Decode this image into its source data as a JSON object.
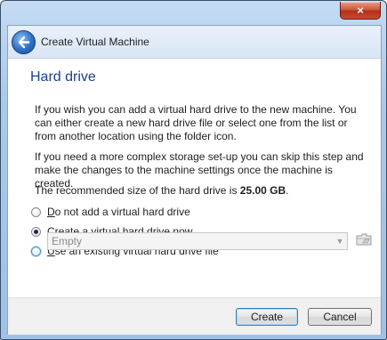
{
  "window": {
    "title": "Create Virtual Machine",
    "close_label": "×"
  },
  "page": {
    "title": "Hard drive",
    "paragraph1": "If you wish you can add a virtual hard drive to the new machine. You can either create a new hard drive file or select one from the list or from another location using the folder icon.",
    "paragraph2": "If you need a more complex storage set-up you can skip this step and make the changes to the machine settings once the machine is created.",
    "recommended_prefix": "The recommended size of the hard drive is ",
    "recommended_value": "25.00 GB",
    "recommended_suffix": "."
  },
  "options": [
    {
      "mnemonic": "D",
      "rest": "o not add a virtual hard drive",
      "checked": false
    },
    {
      "mnemonic": "C",
      "rest": "reate a virtual hard drive now",
      "checked": true
    },
    {
      "mnemonic": "U",
      "rest": "se an existing virtual hard drive file",
      "checked": false
    }
  ],
  "file_select": {
    "value": "Empty"
  },
  "buttons": {
    "create": "Create",
    "cancel": "Cancel"
  },
  "icons": {
    "back": "back-arrow-icon",
    "folder": "folder-icon",
    "dropdown": "chevron-down-icon",
    "close": "close-icon"
  },
  "colors": {
    "title_blue": "#1c3f94",
    "close_red": "#c94b2d",
    "default_button_border": "#3c7fb1"
  }
}
